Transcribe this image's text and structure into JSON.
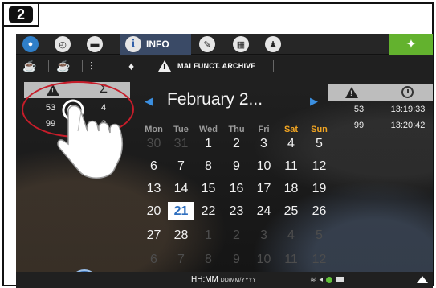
{
  "step": {
    "number": "2"
  },
  "top_bar": {
    "info_label": "INFO",
    "icons": [
      "water-drop-icon",
      "clock-icon",
      "folder-icon",
      "info-icon",
      "pencil-icon",
      "calculator-icon",
      "user-icon",
      "wrench-icon"
    ]
  },
  "sub_bar": {
    "malfunction_archive_label": "MALFUNCT. ARCHIVE",
    "icons": [
      "coffee-cup-icon",
      "cup-steam-icon",
      "settings-sliders-icon",
      "drop-icon",
      "warning-icon"
    ]
  },
  "left_summary": {
    "header_icons": [
      "warning-icon",
      "sigma-icon"
    ],
    "rows": [
      {
        "code": "53",
        "count": "4"
      },
      {
        "code": "99",
        "count": "2"
      }
    ]
  },
  "right_log": {
    "header_icons": [
      "warning-icon",
      "clock-icon"
    ],
    "rows": [
      {
        "code": "53",
        "time": "13:19:33"
      },
      {
        "code": "99",
        "time": "13:20:42"
      }
    ]
  },
  "calendar": {
    "month_label": "February 2...",
    "weekdays": [
      "Mon",
      "Tue",
      "Wed",
      "Thu",
      "Fri",
      "Sat",
      "Sun"
    ],
    "weekend_color": "#f0a422",
    "selected_day": "21",
    "weeks": [
      [
        "30",
        "31",
        "1",
        "2",
        "3",
        "4",
        "5"
      ],
      [
        "6",
        "7",
        "8",
        "9",
        "10",
        "11",
        "12"
      ],
      [
        "13",
        "14",
        "15",
        "16",
        "17",
        "18",
        "19"
      ],
      [
        "20",
        "21",
        "22",
        "23",
        "24",
        "25",
        "26"
      ],
      [
        "27",
        "28",
        "1",
        "2",
        "3",
        "4",
        "5"
      ],
      [
        "6",
        "7",
        "8",
        "9",
        "10",
        "11",
        "12"
      ]
    ]
  },
  "bottom_bar": {
    "time_format": "HH:MM",
    "date_format": "DD/MM/YYYY"
  },
  "colors": {
    "accent_blue": "#3b8fe0",
    "brand_green": "#63b22e",
    "annotation_red": "#c71d2a"
  }
}
